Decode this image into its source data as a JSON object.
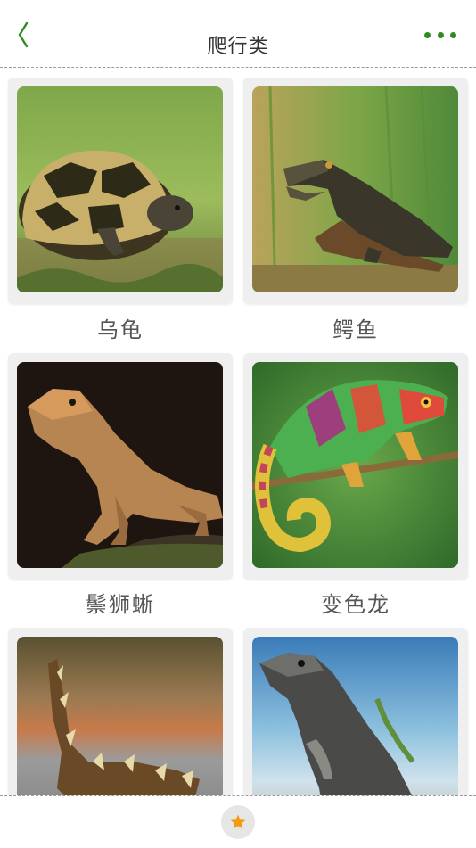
{
  "header": {
    "title": "爬行类",
    "back_icon": "chevron-left-icon",
    "more_icon": "more-dots-icon",
    "accent_color": "#2e8b1e"
  },
  "animals": [
    {
      "label": "乌龟",
      "image": "tortoise-photo"
    },
    {
      "label": "鳄鱼",
      "image": "crocodile-photo"
    },
    {
      "label": "鬃狮蜥",
      "image": "bearded-dragon-photo"
    },
    {
      "label": "变色龙",
      "image": "chameleon-photo"
    },
    {
      "label": "",
      "image": "thorny-devil-photo"
    },
    {
      "label": "",
      "image": "iguana-photo"
    }
  ],
  "bottom_bar": {
    "favorite_icon": "star-icon",
    "favorite_color": "#f39c12"
  }
}
